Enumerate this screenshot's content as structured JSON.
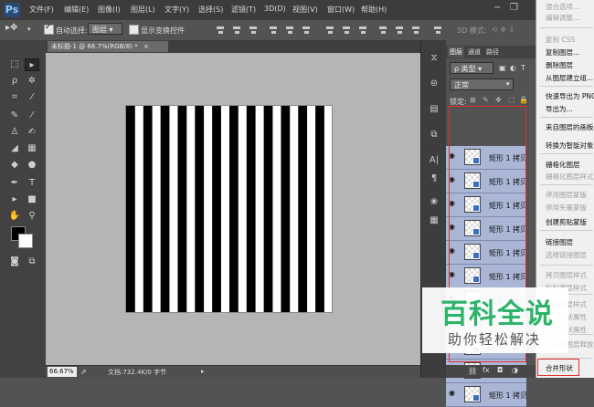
{
  "app": {
    "logo": "Ps"
  },
  "menubar": {
    "items": [
      "文件(F)",
      "编辑(E)",
      "图像(I)",
      "图层(L)",
      "文字(Y)",
      "选择(S)",
      "滤镜(T)",
      "3D(D)",
      "视图(V)",
      "窗口(W)",
      "帮助(H)"
    ],
    "minimize": "−",
    "restore": "❐"
  },
  "options": {
    "auto_select_label": "自动选择:",
    "auto_select_checked": true,
    "auto_select_value": "图层",
    "show_transform_label": "显示变换控件",
    "show_transform_checked": false,
    "mode_3d_label": "3D 模式:"
  },
  "document": {
    "tab_title": "未标题-1 @ 66.7%(RGB/8) *",
    "close": "×",
    "zoom": "66.67%",
    "doc_info": "文档:732.4K/0 字节"
  },
  "artboard": {
    "stripe_count": 12,
    "stripe_color": "#000000",
    "bg_color": "#ffffff"
  },
  "layers_panel": {
    "tabs": [
      "图层",
      "通道",
      "路径"
    ],
    "filter_label": "ρ 类型",
    "blend_mode": "正常",
    "lock_label": "锁定:",
    "layer_name": "矩形 1 拷贝",
    "layer_count": 11
  },
  "context_menu": {
    "items": [
      {
        "label": "混合选项...",
        "enabled": false
      },
      {
        "label": "编辑调整...",
        "enabled": false
      },
      {
        "label": "复制 CSS",
        "enabled": false
      },
      {
        "label": "复制图层...",
        "enabled": true
      },
      {
        "label": "删除图层",
        "enabled": true
      },
      {
        "label": "从图层建立组...",
        "enabled": true
      },
      {
        "label": "快速导出为 PNG",
        "enabled": true
      },
      {
        "label": "导出为...",
        "enabled": true
      },
      {
        "label": "来自图层的画板...",
        "enabled": true
      },
      {
        "label": "转换为智能对象",
        "enabled": true
      },
      {
        "label": "栅格化图层",
        "enabled": true
      },
      {
        "label": "栅格化图层样式",
        "enabled": false
      },
      {
        "label": "停用图层蒙版",
        "enabled": false
      },
      {
        "label": "停用矢量蒙版",
        "enabled": false
      },
      {
        "label": "创建剪贴蒙版",
        "enabled": true
      },
      {
        "label": "链接图层",
        "enabled": true
      },
      {
        "label": "选择链接图层",
        "enabled": false
      },
      {
        "label": "拷贝图层样式",
        "enabled": false
      },
      {
        "label": "粘贴图层样式",
        "enabled": false
      },
      {
        "label": "清除图层样式",
        "enabled": false
      },
      {
        "label": "复制形状属性",
        "enabled": false
      },
      {
        "label": "粘贴形状属性",
        "enabled": false
      },
      {
        "label": "从隔离图层释放",
        "enabled": false
      },
      {
        "label": "合并形状",
        "enabled": true
      }
    ]
  },
  "watermark": {
    "title": "百科全说",
    "subtitle": "助你轻松解决"
  },
  "colors": {
    "accent": "#e03030",
    "layer_selected": "#aab6d6",
    "watermark_green": "#2db36a"
  }
}
